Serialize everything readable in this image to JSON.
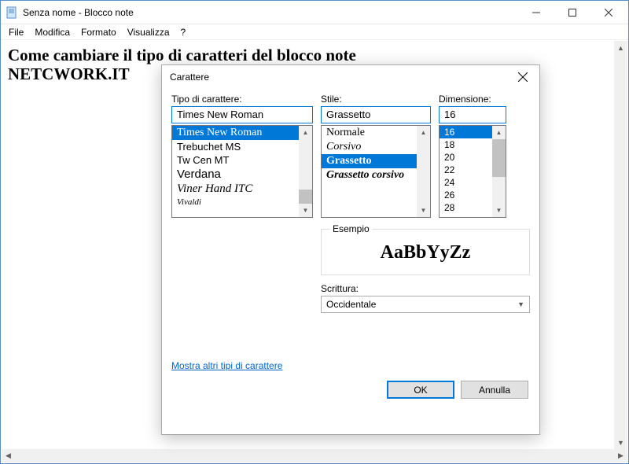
{
  "window": {
    "title": "Senza nome - Blocco note"
  },
  "menubar": {
    "file": "File",
    "edit": "Modifica",
    "format": "Formato",
    "view": "Visualizza",
    "help": "?"
  },
  "editor": {
    "line1": "Come cambiare il tipo di caratteri del blocco note",
    "line2": "NETCWORK.IT"
  },
  "dialog": {
    "title": "Carattere",
    "font_label": "Tipo di carattere:",
    "font_value": "Times New Roman",
    "font_list": {
      "0": "Times New Roman",
      "1": "Trebuchet MS",
      "2": "Tw Cen MT",
      "3": "Verdana",
      "4": "Viner Hand ITC",
      "5": "Vivaldi"
    },
    "style_label": "Stile:",
    "style_value": "Grassetto",
    "style_list": {
      "0": "Normale",
      "1": "Corsivo",
      "2": "Grassetto",
      "3": "Grassetto corsivo"
    },
    "size_label": "Dimensione:",
    "size_value": "16",
    "size_list": {
      "0": "16",
      "1": "18",
      "2": "20",
      "3": "22",
      "4": "24",
      "5": "26",
      "6": "28"
    },
    "sample_label": "Esempio",
    "sample_text": "AaBbYyZz",
    "script_label": "Scrittura:",
    "script_value": "Occidentale",
    "link": "Mostra altri tipi di carattere",
    "ok": "OK",
    "cancel": "Annulla"
  }
}
